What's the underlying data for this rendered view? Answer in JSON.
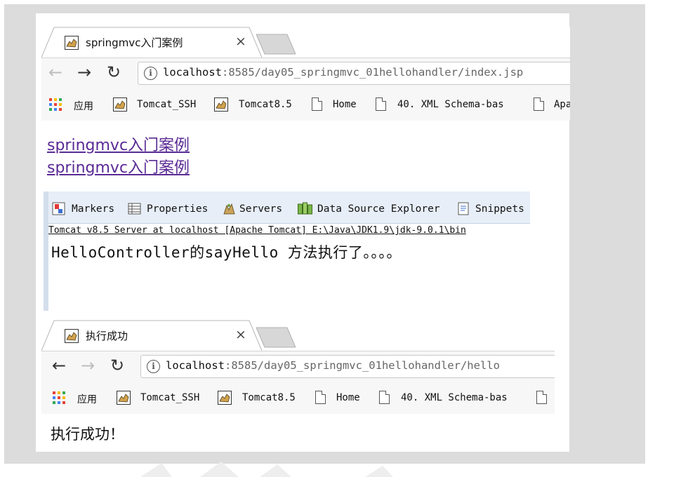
{
  "browser1": {
    "tab_title": "springmvc入门案例",
    "url_host": "localhost",
    "url_path": ":8585/day05_springmvc_01hellohandler/index.jsp",
    "back_icon": "←",
    "forward_icon": "→",
    "reload_icon": "↻",
    "close_icon": "×",
    "info_icon": "i",
    "bookmarks": [
      {
        "label": "应用",
        "icon": "apps-grid-icon"
      },
      {
        "label": "Tomcat_SSH",
        "icon": "tomcat-icon"
      },
      {
        "label": "Tomcat8.5",
        "icon": "tomcat-icon"
      },
      {
        "label": "Home",
        "icon": "page-icon"
      },
      {
        "label": "40.  XML Schema-bas",
        "icon": "page-icon"
      },
      {
        "label": "Apa",
        "icon": "page-icon"
      }
    ],
    "nav_forward_enabled": true
  },
  "page1": {
    "links": [
      "springmvc入门案例",
      "springmvc入门案例"
    ],
    "link_color": "#5a2a95"
  },
  "console": {
    "tabs": [
      {
        "label": "Markers",
        "icon": "markers-icon"
      },
      {
        "label": "Properties",
        "icon": "properties-icon"
      },
      {
        "label": "Servers",
        "icon": "servers-icon"
      },
      {
        "label": "Data Source Explorer",
        "icon": "data-source-icon"
      },
      {
        "label": "Snippets",
        "icon": "snippets-icon"
      }
    ],
    "header": "Tomcat v8.5 Server at localhost [Apache Tomcat] E:\\Java\\JDK1.9\\jdk-9.0.1\\bin",
    "output": "HelloController的sayHello 方法执行了。。。。"
  },
  "browser2": {
    "tab_title": "执行成功",
    "url_host": "localhost",
    "url_path": ":8585/day05_springmvc_01hellohandler/hello",
    "back_icon": "←",
    "forward_icon": "→",
    "reload_icon": "↻",
    "close_icon": "×",
    "info_icon": "i",
    "bookmarks": [
      {
        "label": "应用",
        "icon": "apps-grid-icon"
      },
      {
        "label": "Tomcat_SSH",
        "icon": "tomcat-icon"
      },
      {
        "label": "Tomcat8.5",
        "icon": "tomcat-icon"
      },
      {
        "label": "Home",
        "icon": "page-icon"
      },
      {
        "label": "40.  XML Schema-bas",
        "icon": "page-icon"
      },
      {
        "label": "",
        "icon": "page-icon"
      }
    ],
    "nav_forward_enabled": false
  },
  "page2": {
    "message": "执行成功！"
  }
}
